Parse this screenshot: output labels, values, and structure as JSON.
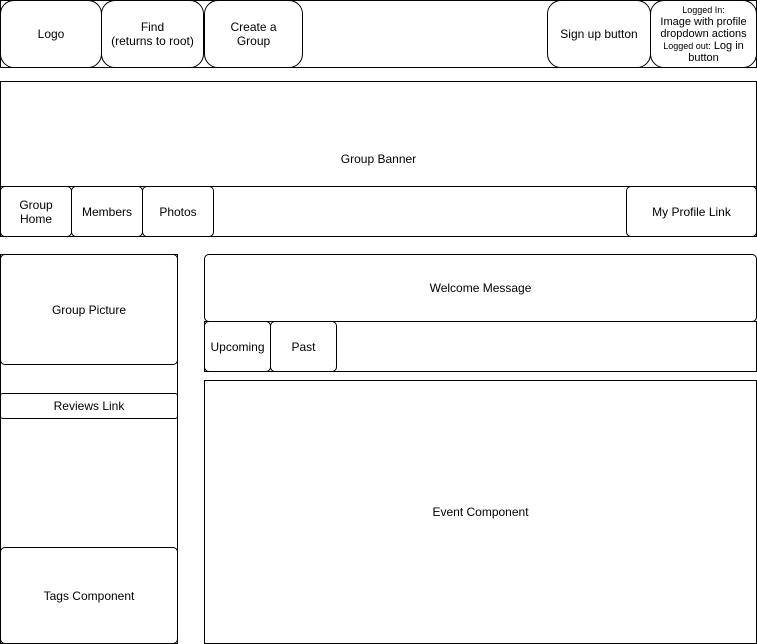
{
  "header": {
    "logo": "Logo",
    "find": "Find\n(returns to root)",
    "create_group": "Create a\nGroup",
    "sign_up": "Sign up button",
    "profile": {
      "logged_in_label": "Logged In:",
      "logged_in_desc": "Image with profile dropdown actions",
      "logged_out_label": "Logged out:",
      "logged_out_desc": "Log in button"
    }
  },
  "banner": {
    "title": "Group Banner"
  },
  "group_nav": {
    "home": "Group\nHome",
    "members": "Members",
    "photos": "Photos",
    "my_profile": "My Profile Link"
  },
  "sidebar": {
    "group_picture": "Group Picture",
    "reviews_link": "Reviews Link",
    "tags": "Tags Component"
  },
  "main": {
    "welcome": "Welcome Message",
    "tabs": {
      "upcoming": "Upcoming",
      "past": "Past"
    },
    "events": "Event Component"
  }
}
